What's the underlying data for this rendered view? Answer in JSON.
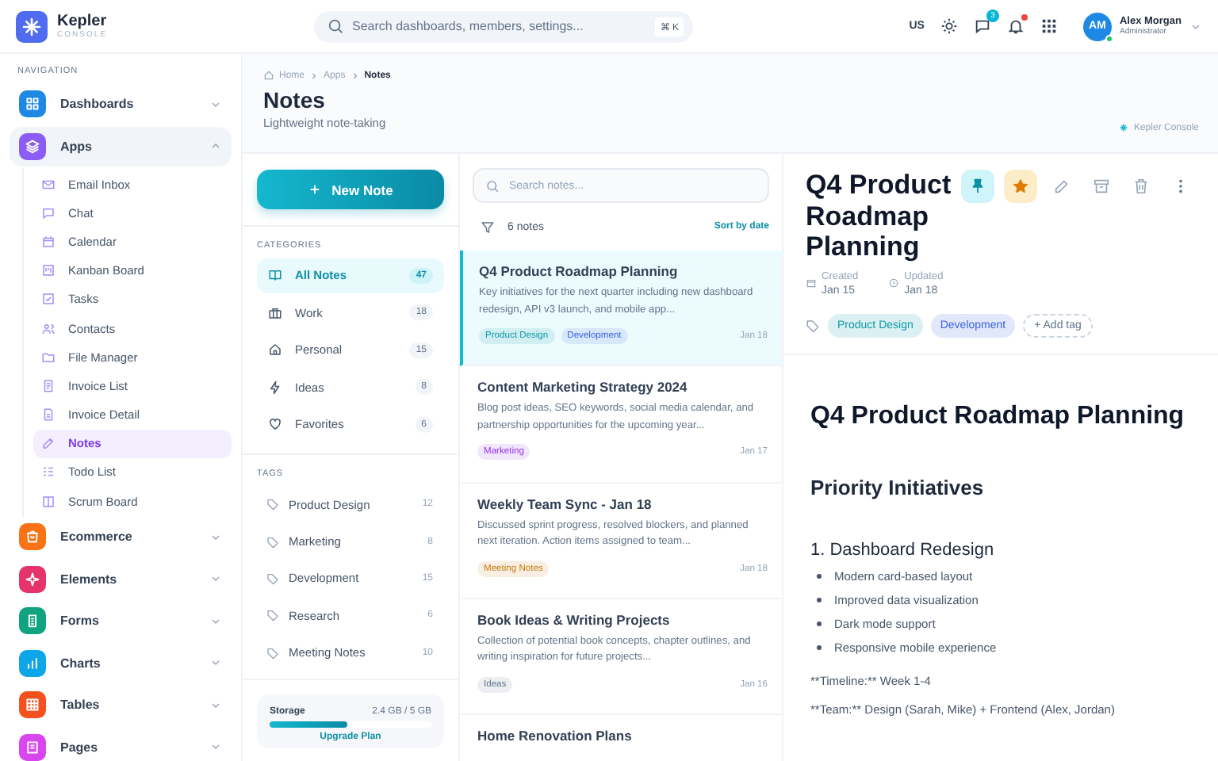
{
  "brand": {
    "name": "Kepler",
    "subtitle": "CONSOLE"
  },
  "topbar": {
    "search_placeholder": "Search dashboards, members, settings...",
    "shortcut": "⌘ K",
    "language": "US",
    "messages_badge": "3",
    "notifications_unread": true,
    "user": {
      "initials": "AM",
      "name": "Alex Morgan",
      "role": "Administrator",
      "online": true
    }
  },
  "sidebar": {
    "section": "NAVIGATION",
    "items": [
      {
        "label": "Dashboards",
        "color": "#1e88e5",
        "expanded": false
      },
      {
        "label": "Apps",
        "color": "#8b5cf6",
        "expanded": true,
        "children": [
          {
            "label": "Email Inbox",
            "selected": false
          },
          {
            "label": "Chat",
            "selected": false
          },
          {
            "label": "Calendar",
            "selected": false
          },
          {
            "label": "Kanban Board",
            "selected": false
          },
          {
            "label": "Tasks",
            "selected": false
          },
          {
            "label": "Contacts",
            "selected": false
          },
          {
            "label": "File Manager",
            "selected": false
          },
          {
            "label": "Invoice List",
            "selected": false
          },
          {
            "label": "Invoice Detail",
            "selected": false
          },
          {
            "label": "Notes",
            "selected": true
          },
          {
            "label": "Todo List",
            "selected": false
          },
          {
            "label": "Scrum Board",
            "selected": false
          }
        ]
      },
      {
        "label": "Ecommerce",
        "color": "#f97316",
        "expanded": false
      },
      {
        "label": "Elements",
        "color": "#e6336b",
        "expanded": false
      },
      {
        "label": "Forms",
        "color": "#10a37f",
        "expanded": false
      },
      {
        "label": "Charts",
        "color": "#0ea5e9",
        "expanded": false
      },
      {
        "label": "Tables",
        "color": "#f4511e",
        "expanded": false
      },
      {
        "label": "Pages",
        "color": "#d946ef",
        "expanded": false
      }
    ]
  },
  "page": {
    "breadcrumb": [
      "Home",
      "Apps",
      "Notes"
    ],
    "title": "Notes",
    "subtitle": "Lightweight note-taking",
    "brand_link": "Kepler Console"
  },
  "categories_panel": {
    "new_button": "New Note",
    "categories_heading": "CATEGORIES",
    "categories": [
      {
        "label": "All Notes",
        "count": "47",
        "selected": true
      },
      {
        "label": "Work",
        "count": "18",
        "selected": false
      },
      {
        "label": "Personal",
        "count": "15",
        "selected": false
      },
      {
        "label": "Ideas",
        "count": "8",
        "selected": false
      },
      {
        "label": "Favorites",
        "count": "6",
        "selected": false
      }
    ],
    "tags_heading": "TAGS",
    "tags": [
      {
        "label": "Product Design",
        "count": "12"
      },
      {
        "label": "Marketing",
        "count": "8"
      },
      {
        "label": "Development",
        "count": "15"
      },
      {
        "label": "Research",
        "count": "6"
      },
      {
        "label": "Meeting Notes",
        "count": "10"
      }
    ],
    "storage": {
      "label": "Storage",
      "reading": "2.4 GB / 5 GB",
      "level": 0.48,
      "link": "Upgrade Plan"
    }
  },
  "notes_list": {
    "search_placeholder": "Search notes...",
    "count": "6 notes",
    "sort": "Sort by date",
    "notes": [
      {
        "title": "Q4 Product Roadmap Planning",
        "excerpt": "Key initiatives for the next quarter including new dashboard redesign, API v3 launch, and mobile app...",
        "tags": [
          {
            "label": "Product Design",
            "color": "#0e9aa7"
          },
          {
            "label": "Development",
            "color": "#3b63e0"
          }
        ],
        "date": "Jan 18",
        "selected": true
      },
      {
        "title": "Content Marketing Strategy 2024",
        "excerpt": "Blog post ideas, SEO keywords, social media calendar, and partnership opportunities for the upcoming year...",
        "tags": [
          {
            "label": "Marketing",
            "color": "#9333ea"
          }
        ],
        "date": "Jan 17",
        "selected": false
      },
      {
        "title": "Weekly Team Sync - Jan 18",
        "excerpt": "Discussed sprint progress, resolved blockers, and planned next iteration. Action items assigned to team...",
        "tags": [
          {
            "label": "Meeting Notes",
            "color": "#c27a0e"
          }
        ],
        "date": "Jan 18",
        "selected": false
      },
      {
        "title": "Book Ideas & Writing Projects",
        "excerpt": "Collection of potential book concepts, chapter outlines, and writing inspiration for future projects...",
        "tags": [
          {
            "label": "Ideas",
            "color": "#64748b"
          }
        ],
        "date": "Jan 16",
        "selected": false
      },
      {
        "title": "Home Renovation Plans",
        "selected": false
      }
    ]
  },
  "detail": {
    "title": "Q4 Product Roadmap Planning",
    "pinned": true,
    "starred": true,
    "created_label": "Created",
    "created": "Jan 15",
    "updated_label": "Updated",
    "updated": "Jan 18",
    "tags": [
      {
        "label": "Product Design",
        "color": "#0e9aa7"
      },
      {
        "label": "Development",
        "color": "#3b63e0"
      }
    ],
    "add_tag": "+ Add tag",
    "body": [
      {
        "kind": "h1",
        "text": "Q4 Product Roadmap Planning"
      },
      {
        "kind": "h2",
        "text": "Priority Initiatives"
      },
      {
        "kind": "h3",
        "text": "1. Dashboard Redesign"
      },
      {
        "kind": "list",
        "items": [
          "Modern card-based layout",
          "Improved data visualization",
          "Dark mode support",
          "Responsive mobile experience"
        ]
      },
      {
        "kind": "p",
        "text": "**Timeline:** Week 1-4"
      },
      {
        "kind": "p",
        "text": "**Team:** Design (Sarah, Mike) + Frontend (Alex, Jordan)"
      }
    ]
  }
}
